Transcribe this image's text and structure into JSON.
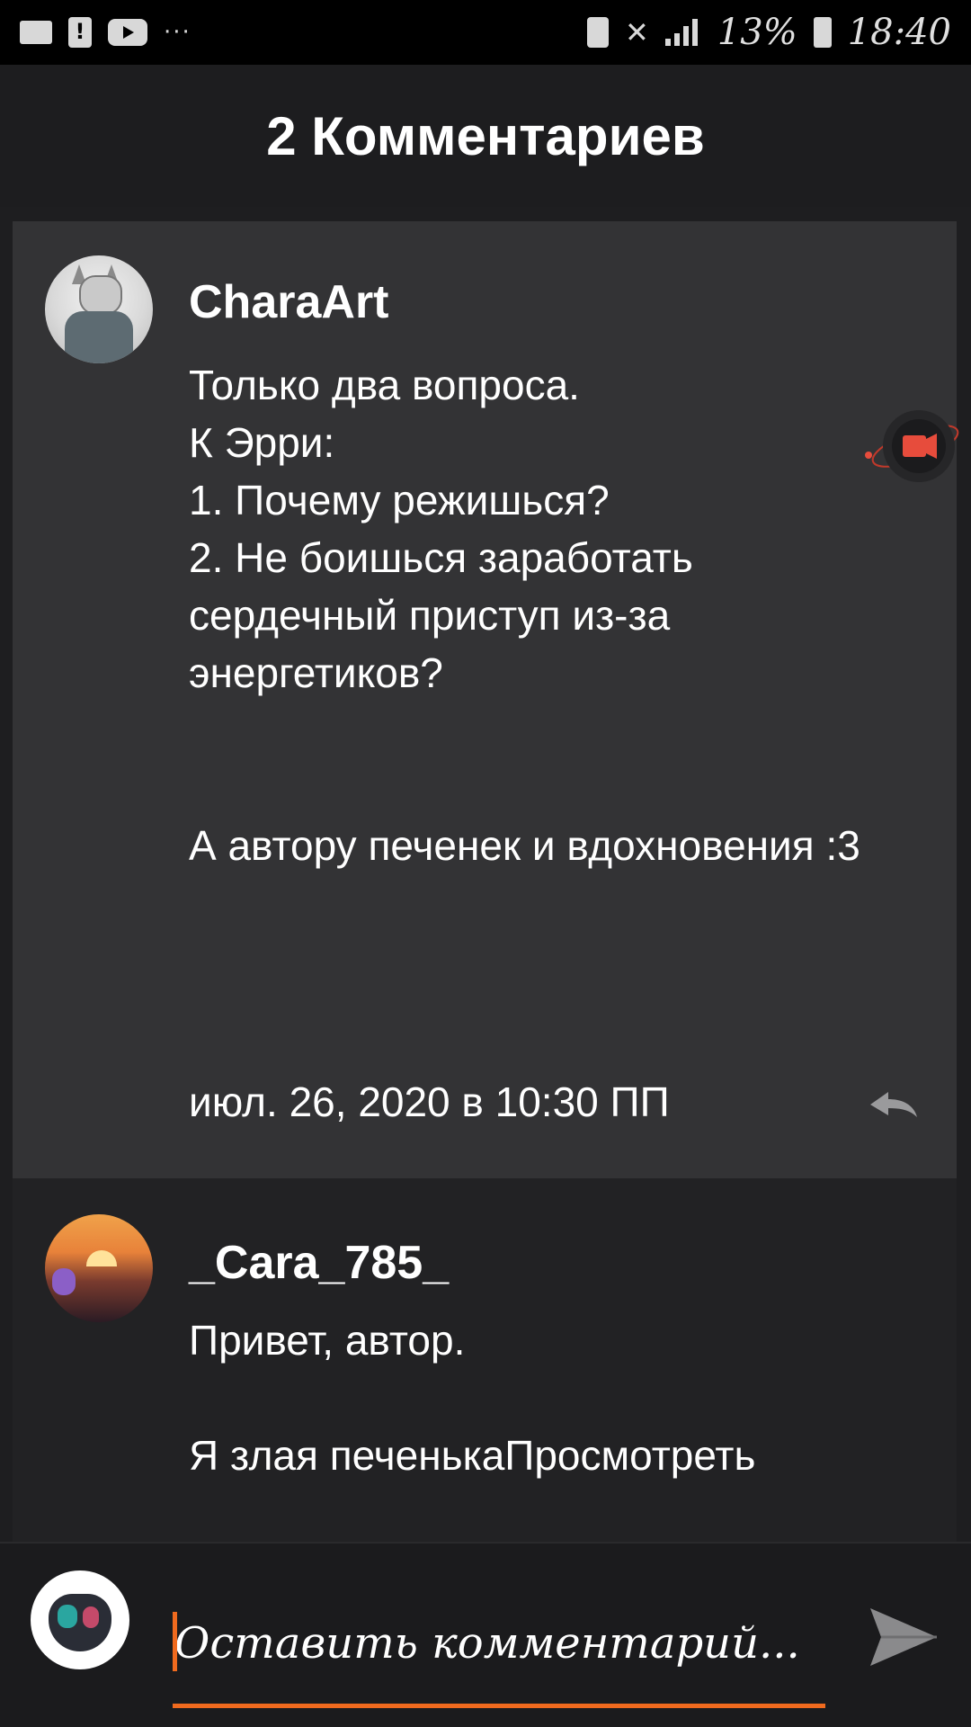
{
  "status_bar": {
    "battery_percent": "13%",
    "time": "18:40",
    "icons": [
      "folder-icon",
      "alert-icon",
      "video-icon",
      "more-icon",
      "battery-saver-icon",
      "mute-icon",
      "signal-icon",
      "battery-icon"
    ]
  },
  "header": {
    "title": "2 Комментариев"
  },
  "comments": [
    {
      "username": "CharaArt",
      "body": "Только два вопроса.\nК Эрри:\n1. Почему режишься?\n2. Не боишься заработать сердечный приступ из-за энергетиков?\n\n\nА автору печенек и вдохновения :3",
      "timestamp": "июл. 26, 2020 в 10:30 ПП",
      "reply_icon": "reply-icon"
    },
    {
      "username": "_Cara_785_",
      "body": "Привет, автор.\n\nЯ злая печенькаПросмотреть"
    }
  ],
  "input": {
    "placeholder": "Оставить комментарий...",
    "send_icon": "send-icon",
    "accent": "#f06a1e"
  },
  "colors": {
    "background": "#1e1e20",
    "comment_highlight": "#333335",
    "comment_normal": "#222224"
  }
}
